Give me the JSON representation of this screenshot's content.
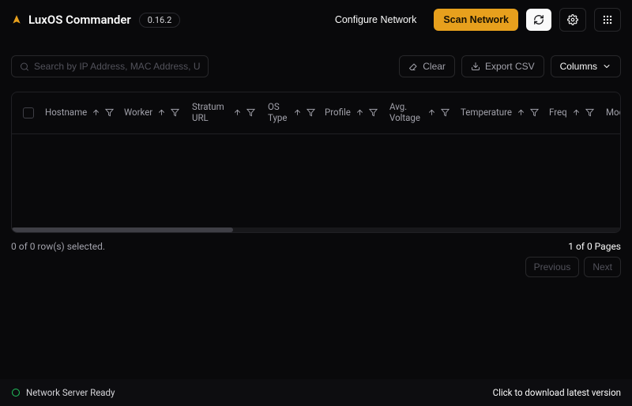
{
  "header": {
    "app_name": "LuxOS Commander",
    "version": "0.16.2",
    "configure_label": "Configure Network",
    "scan_label": "Scan Network"
  },
  "toolbar": {
    "search_placeholder": "Search by IP Address, MAC Address, Username or Worker",
    "clear_label": "Clear",
    "export_label": "Export CSV",
    "columns_label": "Columns"
  },
  "table": {
    "columns": [
      {
        "label": "Hostname"
      },
      {
        "label": "Worker"
      },
      {
        "label": "Stratum URL"
      },
      {
        "label": "OS Type"
      },
      {
        "label": "Profile"
      },
      {
        "label": "Avg. Voltage"
      },
      {
        "label": "Temperature"
      },
      {
        "label": "Freq"
      },
      {
        "label": "Model"
      }
    ]
  },
  "footer": {
    "selection_text": "0 of 0 row(s) selected.",
    "page_text": "1 of 0 Pages",
    "prev_label": "Previous",
    "next_label": "Next"
  },
  "status": {
    "ready_text": "Network Server Ready",
    "download_text": "Click to download latest version"
  }
}
